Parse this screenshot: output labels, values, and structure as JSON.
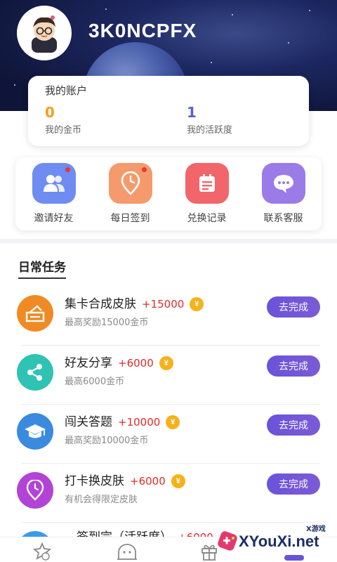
{
  "header": {
    "username": "3K0NCPFX"
  },
  "account": {
    "title": "我的账户",
    "coins": {
      "value": "0",
      "label": "我的金币"
    },
    "activity": {
      "value": "1",
      "label": "我的活跃度"
    }
  },
  "quick_actions": [
    {
      "label": "邀请好友",
      "icon": "invite-friends-icon",
      "color": "#6f8cf2"
    },
    {
      "label": "每日签到",
      "icon": "daily-checkin-icon",
      "color": "#f59a6c"
    },
    {
      "label": "兑换记录",
      "icon": "exchange-record-icon",
      "color": "#f2656a"
    },
    {
      "label": "联系客服",
      "icon": "customer-service-icon",
      "color": "#9b7be8"
    }
  ],
  "tasks_section": {
    "title": "日常任务"
  },
  "tasks": [
    {
      "name": "集卡合成皮肤",
      "reward": "+15000",
      "desc": "最高奖励15000金币",
      "button": "去完成",
      "icon": "card-collect-icon",
      "color": "#f08a24"
    },
    {
      "name": "好友分享",
      "reward": "+6000",
      "desc": "最高6000金币",
      "button": "去完成",
      "icon": "share-icon",
      "color": "#2ec3b3"
    },
    {
      "name": "闯关答题",
      "reward": "+10000",
      "desc": "最高奖励10000金币",
      "button": "去完成",
      "icon": "graduation-cap-icon",
      "color": "#3a8be0"
    },
    {
      "name": "打卡换皮肤",
      "reward": "+6000",
      "desc": "有机会得限定皮肤",
      "button": "去完成",
      "icon": "location-clock-icon",
      "color": "#b243d6"
    }
  ],
  "partial_task": {
    "name": "…签到完（活跃度）",
    "reward": "+6000"
  },
  "coin_symbol": "¥",
  "watermark": {
    "text": "XYouXi.net",
    "small": "X游戏"
  },
  "colors": {
    "accent": "#6a53d9",
    "reward": "#e02a2a",
    "coins": "#f0a020",
    "activity": "#5a5fd6"
  }
}
